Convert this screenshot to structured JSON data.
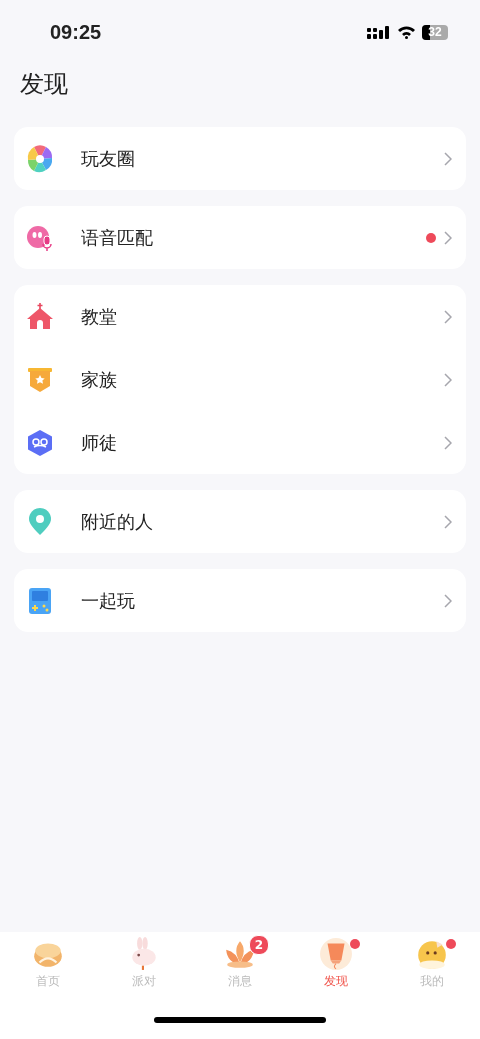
{
  "status_bar": {
    "time": "09:25",
    "battery": "32"
  },
  "title": "发现",
  "groups": [
    {
      "items": [
        {
          "label": "玩友圈",
          "dot": false
        }
      ]
    },
    {
      "items": [
        {
          "label": "语音匹配",
          "dot": true
        }
      ]
    },
    {
      "items": [
        {
          "label": "教堂",
          "dot": false
        },
        {
          "label": "家族",
          "dot": false
        },
        {
          "label": "师徒",
          "dot": false
        }
      ]
    },
    {
      "items": [
        {
          "label": "附近的人",
          "dot": false
        }
      ]
    },
    {
      "items": [
        {
          "label": "一起玩",
          "dot": false
        }
      ]
    }
  ],
  "tab_bar": [
    {
      "label": "首页",
      "selected": false,
      "dot": false
    },
    {
      "label": "派对",
      "selected": false,
      "dot": false
    },
    {
      "label": "消息",
      "selected": false,
      "dot": false,
      "badge": "2"
    },
    {
      "label": "发现",
      "selected": true,
      "dot": true
    },
    {
      "label": "我的",
      "selected": false,
      "dot": true
    }
  ]
}
